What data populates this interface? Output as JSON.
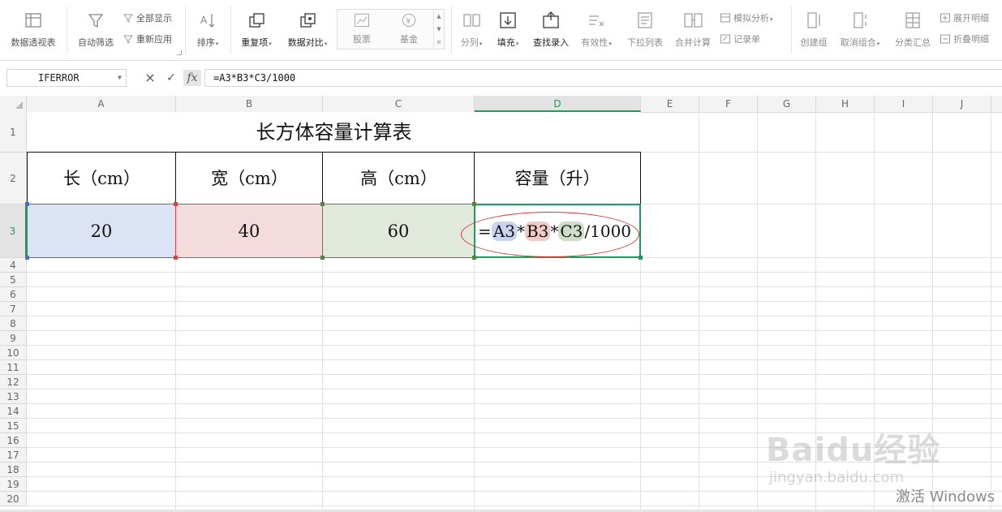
{
  "ribbon": {
    "pivot_table": "数据透视表",
    "auto_filter": "自动筛选",
    "show_all": "全部显示",
    "reapply": "重新应用",
    "sort": "排序",
    "duplicates": "重复项",
    "compare_data": "数据对比",
    "stock": "股票",
    "fund": "基金",
    "text_to_columns": "分列",
    "fill": "填充",
    "find_entry": "查找录入",
    "validity": "有效性",
    "dropdown_list": "下拉列表",
    "consolidate": "合并计算",
    "what_if": "模拟分析",
    "record_form": "记录单",
    "create_group": "创建组",
    "ungroup": "取消组合",
    "subtotal": "分类汇总",
    "expand_detail": "展开明细",
    "collapse_detail": "折叠明细"
  },
  "formula_bar": {
    "name_box": "IFERROR",
    "cancel": "×",
    "confirm": "✓",
    "fx": "fx",
    "formula": "=A3*B3*C3/1000"
  },
  "columns": [
    "A",
    "B",
    "C",
    "D",
    "E",
    "F",
    "G",
    "H",
    "I",
    "J"
  ],
  "rows": [
    "1",
    "2",
    "3",
    "4",
    "5",
    "6",
    "7",
    "8",
    "9",
    "10",
    "11",
    "12",
    "13",
    "14",
    "15",
    "16",
    "17",
    "18",
    "19",
    "20"
  ],
  "sheet": {
    "title": "长方体容量计算表",
    "headers": [
      "长（cm）",
      "宽（cm）",
      "高（cm）",
      "容量（升）"
    ],
    "values": [
      "20",
      "40",
      "60"
    ],
    "formula_parts": {
      "eq": "=",
      "ref1": "A3",
      "op1": "*",
      "ref2": "B3",
      "op2": "*",
      "ref3": "C3",
      "tail": "/1000"
    }
  },
  "colors": {
    "accent": "#1f9a5a",
    "ref_blue": "#c9d4f0",
    "ref_red": "#f2c9c9",
    "ref_green": "#cfdcc7",
    "annotation": "#d9322e"
  },
  "watermark": {
    "brand": "Baidu经验",
    "url": "jingyan.baidu.com",
    "activate": "激活 Windows"
  }
}
